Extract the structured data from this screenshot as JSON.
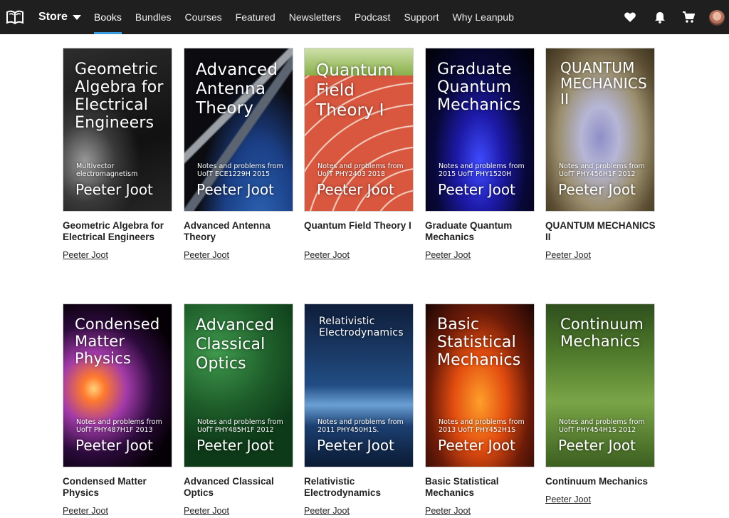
{
  "nav": {
    "store_label": "Store",
    "links": [
      "Books",
      "Bundles",
      "Courses",
      "Featured",
      "Newsletters",
      "Podcast",
      "Support",
      "Why Leanpub"
    ],
    "active": "Books",
    "icons": [
      "heart-icon",
      "bell-icon",
      "cart-icon",
      "avatar"
    ]
  },
  "books": [
    {
      "title": "Geometric Algebra for Electrical Engineers",
      "author": "Peeter Joot",
      "cover": {
        "title": "Geometric Algebra for Electrical Engineers",
        "subtitle": "Multivector electromagnetism",
        "author": "Peeter Joot"
      }
    },
    {
      "title": "Advanced Antenna Theory",
      "author": "Peeter Joot",
      "cover": {
        "title": "Advanced Antenna Theory",
        "subtitle": "Notes and problems from UofT ECE1229H 2015",
        "author": "Peeter Joot"
      }
    },
    {
      "title": "Quantum Field Theory I",
      "author": "Peeter Joot",
      "cover": {
        "title": "Quantum Field Theory I",
        "subtitle": "Notes and problems from UofT PHY2403 2018",
        "author": "Peeter Joot"
      }
    },
    {
      "title": "Graduate Quantum Mechanics",
      "author": "Peeter Joot",
      "cover": {
        "title": "Graduate Quantum Mechanics",
        "subtitle": "Notes and problems from 2015 UofT PHY1520H",
        "author": "Peeter Joot"
      }
    },
    {
      "title": "QUANTUM MECHANICS II",
      "author": "Peeter Joot",
      "cover": {
        "title": "QUANTUM MECHANICS II",
        "subtitle": "Notes and problems from UofT PHY456H1F 2012",
        "author": "Peeter Joot"
      }
    },
    {
      "title": "Condensed Matter Physics",
      "author": "Peeter Joot",
      "cover": {
        "title": "Condensed Matter Physics",
        "subtitle": "Notes and problems from UofT PHY487H1F 2013",
        "author": "Peeter Joot"
      }
    },
    {
      "title": "Advanced Classical Optics",
      "author": "Peeter Joot",
      "cover": {
        "title": "Advanced Classical Optics",
        "subtitle": "Notes and problems from UofT PHY485H1F 2012",
        "author": "Peeter Joot"
      }
    },
    {
      "title": "Relativistic Electrodynamics",
      "author": "Peeter Joot",
      "cover": {
        "title": "Relativistic Electrodynamics",
        "subtitle": "Notes and problems from 2011 PHY450H1S.",
        "author": "Peeter Joot"
      }
    },
    {
      "title": "Basic Statistical Mechanics",
      "author": "Peeter Joot",
      "cover": {
        "title": "Basic Statistical Mechanics",
        "subtitle": "Notes and problems from 2013 UofT PHY452H1S",
        "author": "Peeter Joot"
      }
    },
    {
      "title": "Continuum Mechanics",
      "author": "Peeter Joot",
      "cover": {
        "title": "Continuum Mechanics",
        "subtitle": "Notes and problems from UofT PHY454H1S 2012",
        "author": "Peeter Joot"
      }
    }
  ]
}
